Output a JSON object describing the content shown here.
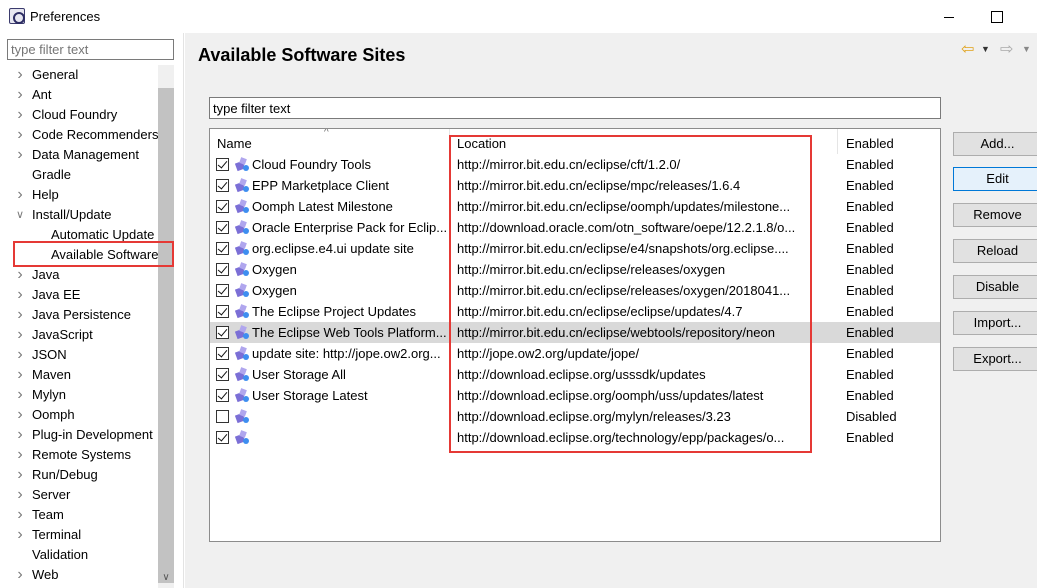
{
  "window": {
    "title": "Preferences"
  },
  "left_pane": {
    "filter_placeholder": "type filter text",
    "tree": [
      {
        "label": "General",
        "expandable": true,
        "child": false
      },
      {
        "label": "Ant",
        "expandable": true,
        "child": false
      },
      {
        "label": "Cloud Foundry",
        "expandable": true,
        "child": false
      },
      {
        "label": "Code Recommenders",
        "expandable": true,
        "child": false
      },
      {
        "label": "Data Management",
        "expandable": true,
        "child": false
      },
      {
        "label": "Gradle",
        "expandable": false,
        "child": false
      },
      {
        "label": "Help",
        "expandable": true,
        "child": false
      },
      {
        "label": "Install/Update",
        "expandable": true,
        "expanded": true,
        "child": false
      },
      {
        "label": "Automatic Update",
        "expandable": false,
        "child": true
      },
      {
        "label": "Available Software",
        "expandable": false,
        "child": true,
        "selected": true
      },
      {
        "label": "Java",
        "expandable": true,
        "child": false
      },
      {
        "label": "Java EE",
        "expandable": true,
        "child": false
      },
      {
        "label": "Java Persistence",
        "expandable": true,
        "child": false
      },
      {
        "label": "JavaScript",
        "expandable": true,
        "child": false
      },
      {
        "label": "JSON",
        "expandable": true,
        "child": false
      },
      {
        "label": "Maven",
        "expandable": true,
        "child": false
      },
      {
        "label": "Mylyn",
        "expandable": true,
        "child": false
      },
      {
        "label": "Oomph",
        "expandable": true,
        "child": false
      },
      {
        "label": "Plug-in Development",
        "expandable": true,
        "child": false
      },
      {
        "label": "Remote Systems",
        "expandable": true,
        "child": false
      },
      {
        "label": "Run/Debug",
        "expandable": true,
        "child": false
      },
      {
        "label": "Server",
        "expandable": true,
        "child": false
      },
      {
        "label": "Team",
        "expandable": true,
        "child": false
      },
      {
        "label": "Terminal",
        "expandable": true,
        "child": false
      },
      {
        "label": "Validation",
        "expandable": false,
        "child": false
      },
      {
        "label": "Web",
        "expandable": true,
        "child": false
      }
    ]
  },
  "main": {
    "title": "Available Software Sites",
    "filter_value": "type filter text",
    "columns": {
      "name": "Name",
      "location": "Location",
      "enabled": "Enabled"
    },
    "rows": [
      {
        "checked": true,
        "name": "Cloud Foundry Tools",
        "location": "http://mirror.bit.edu.cn/eclipse/cft/1.2.0/",
        "enabled": "Enabled"
      },
      {
        "checked": true,
        "name": "EPP Marketplace Client",
        "location": "http://mirror.bit.edu.cn/eclipse/mpc/releases/1.6.4",
        "enabled": "Enabled"
      },
      {
        "checked": true,
        "name": "Oomph Latest Milestone",
        "location": "http://mirror.bit.edu.cn/eclipse/oomph/updates/milestone...",
        "enabled": "Enabled"
      },
      {
        "checked": true,
        "name": "Oracle Enterprise Pack for Eclip...",
        "location": "http://download.oracle.com/otn_software/oepe/12.2.1.8/o...",
        "enabled": "Enabled"
      },
      {
        "checked": true,
        "name": "org.eclipse.e4.ui update site",
        "location": "http://mirror.bit.edu.cn/eclipse/e4/snapshots/org.eclipse....",
        "enabled": "Enabled"
      },
      {
        "checked": true,
        "name": "Oxygen",
        "location": "http://mirror.bit.edu.cn/eclipse/releases/oxygen",
        "enabled": "Enabled"
      },
      {
        "checked": true,
        "name": "Oxygen",
        "location": "http://mirror.bit.edu.cn/eclipse/releases/oxygen/2018041...",
        "enabled": "Enabled"
      },
      {
        "checked": true,
        "name": "The Eclipse Project Updates",
        "location": "http://mirror.bit.edu.cn/eclipse/eclipse/updates/4.7",
        "enabled": "Enabled"
      },
      {
        "checked": true,
        "name": "The Eclipse Web Tools Platform...",
        "location": "http://mirror.bit.edu.cn/eclipse/webtools/repository/neon",
        "enabled": "Enabled",
        "highlight": true
      },
      {
        "checked": true,
        "name": "update site: http://jope.ow2.org...",
        "location": "http://jope.ow2.org/update/jope/",
        "enabled": "Enabled"
      },
      {
        "checked": true,
        "name": "User Storage All",
        "location": "http://download.eclipse.org/usssdk/updates",
        "enabled": "Enabled"
      },
      {
        "checked": true,
        "name": "User Storage Latest",
        "location": "http://download.eclipse.org/oomph/uss/updates/latest",
        "enabled": "Enabled"
      },
      {
        "checked": false,
        "name": "",
        "location": "http://download.eclipse.org/mylyn/releases/3.23",
        "enabled": "Disabled"
      },
      {
        "checked": true,
        "name": "",
        "location": "http://download.eclipse.org/technology/epp/packages/o...",
        "enabled": "Enabled"
      }
    ],
    "buttons": {
      "add": "Add...",
      "edit": "Edit",
      "remove": "Remove",
      "reload": "Reload",
      "disable": "Disable",
      "import": "Import...",
      "export": "Export..."
    }
  },
  "colors": {
    "annotation_red": "#e53935",
    "nav_back_arrow": "#e0a21b"
  }
}
